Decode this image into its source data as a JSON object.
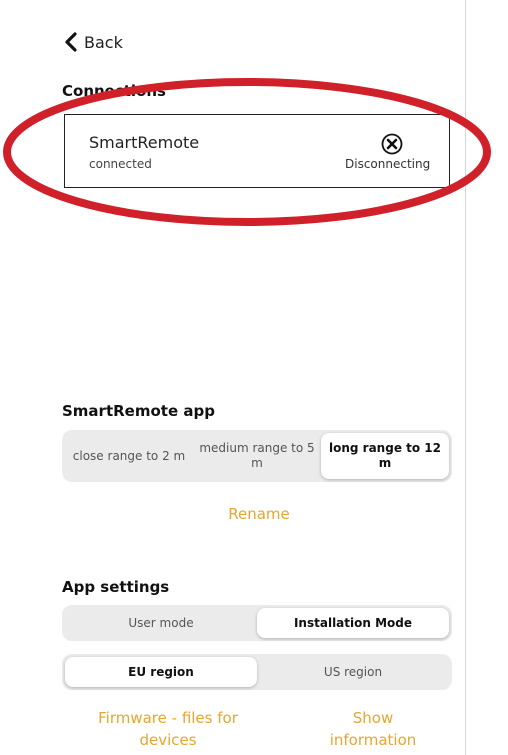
{
  "nav": {
    "back_label": "Back"
  },
  "connections": {
    "heading": "Connections",
    "device_name": "SmartRemote",
    "device_status": "connected",
    "action_label": "Disconnecting"
  },
  "smartremote_app": {
    "heading": "SmartRemote app",
    "range_options": [
      {
        "label": "close range to 2 m",
        "selected": false
      },
      {
        "label": "medium range to 5 m",
        "selected": false
      },
      {
        "label": "long range to 12 m",
        "selected": true
      }
    ],
    "rename_label": "Rename"
  },
  "app_settings": {
    "heading": "App settings",
    "mode_options": [
      {
        "label": "User mode",
        "selected": false
      },
      {
        "label": "Installation Mode",
        "selected": true
      }
    ],
    "region_options": [
      {
        "label": "EU region",
        "selected": true
      },
      {
        "label": "US region",
        "selected": false
      }
    ],
    "firmware_label": "Firmware - files for devices",
    "show_info_label": "Show information"
  },
  "colors": {
    "accent": "#e8a52f",
    "annotation_ring": "#d0202a",
    "segment_bg": "#ebebeb"
  },
  "icons": {
    "back": "chevron-left-icon",
    "disconnect": "close-circle-icon"
  }
}
